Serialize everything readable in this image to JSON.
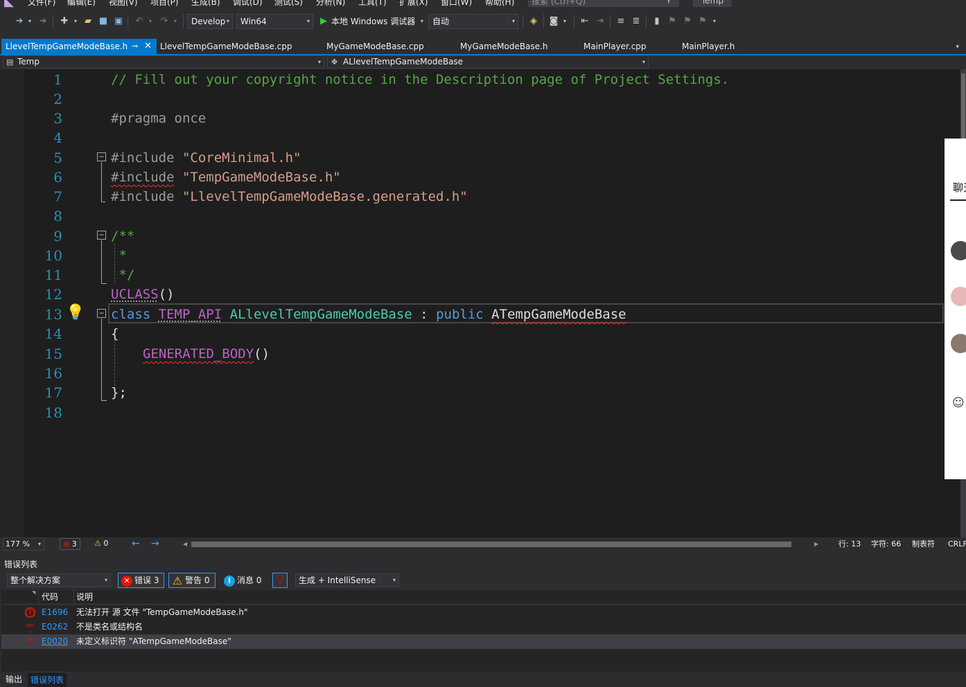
{
  "menubar": {
    "items": [
      "文件(F)",
      "编辑(E)",
      "视图(V)",
      "项目(P)",
      "生成(B)",
      "调试(D)",
      "测试(S)",
      "分析(N)",
      "工具(T)",
      "扩展(X)",
      "窗口(W)",
      "帮助(H)"
    ],
    "search_placeholder": "搜索 (Ctrl+Q)",
    "solution_name": "Temp"
  },
  "toolbar": {
    "configuration": "Develop",
    "platform": "Win64",
    "debugger_label": "本地 Windows 调试器",
    "debugger_mode": "自动"
  },
  "tabs": [
    {
      "label": "LlevelTempGameModeBase.h",
      "active": true
    },
    {
      "label": "LlevelTempGameModeBase.cpp",
      "active": false
    },
    {
      "label": "MyGameModeBase.cpp",
      "active": false
    },
    {
      "label": "MyGameModeBase.h",
      "active": false
    },
    {
      "label": "MainPlayer.cpp",
      "active": false
    },
    {
      "label": "MainPlayer.h",
      "active": false
    }
  ],
  "navbar": {
    "project": "Temp",
    "scope": "ALlevelTempGameModeBase"
  },
  "editor": {
    "line_numbers": [
      "1",
      "2",
      "3",
      "4",
      "5",
      "6",
      "7",
      "8",
      "9",
      "10",
      "11",
      "12",
      "13",
      "14",
      "15",
      "16",
      "17",
      "18"
    ],
    "code": {
      "l1": "// Fill out your copyright notice in the Description page of Project Settings.",
      "l3_pragma": "#pragma",
      "l3_once": " once",
      "l5_inc": "#include",
      "l5_str": "\"CoreMinimal.h\"",
      "l6_inc": "#include",
      "l6_str": "\"TempGameModeBase.h\"",
      "l7_inc": "#include",
      "l7_str": "\"LlevelTempGameModeBase.generated.h\"",
      "l9": "/**",
      "l10": " *",
      "l11": " */",
      "l12_macro": "UCLASS",
      "l12_paren": "()",
      "l13_class": "class",
      "l13_api": "TEMP_API",
      "l13_name": "ALlevelTempGameModeBase",
      "l13_colon": " : ",
      "l13_public": "public",
      "l13_base": "ATempGameModeBase",
      "l14": "{",
      "l15_macro": "GENERATED_BODY",
      "l15_paren": "()",
      "l17": "};"
    }
  },
  "chat_panel": {
    "title": "聊天"
  },
  "statusbar": {
    "zoom": "177 %",
    "error_count": "3",
    "warning_count": "0",
    "line": "行: 13",
    "char": "字符: 66",
    "tab_mode": "制表符",
    "line_ending": "CRLF"
  },
  "error_list": {
    "title": "错误列表",
    "scope": "整个解决方案",
    "errors_label": "错误 3",
    "warnings_label": "警告 0",
    "messages_label": "消息 0",
    "source": "生成 + IntelliSense",
    "columns": {
      "code": "代码",
      "description": "说明"
    },
    "rows": [
      {
        "code": "E1696",
        "description": "无法打开 源 文件 \"TempGameModeBase.h\""
      },
      {
        "code": "E0262",
        "description": "不是类名或结构名"
      },
      {
        "code": "E0020",
        "description": "未定义标识符 \"ATempGameModeBase\""
      }
    ]
  },
  "bottom_tabs": {
    "output": "输出",
    "error_list": "错误列表"
  }
}
